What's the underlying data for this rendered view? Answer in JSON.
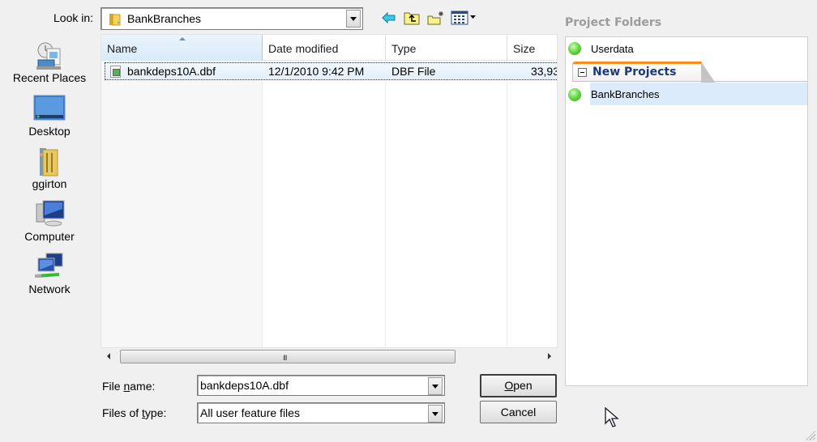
{
  "look_in": {
    "label": "Look in:",
    "label_access_key": "i",
    "value": "BankBranches"
  },
  "toolbar": {
    "icons": [
      "back-arrow-icon",
      "up-folder-icon",
      "new-folder-icon",
      "view-menu-icon"
    ]
  },
  "places": [
    {
      "label": "Recent Places",
      "icon": "recent-places-icon"
    },
    {
      "label": "Desktop",
      "icon": "desktop-icon"
    },
    {
      "label": "ggirton",
      "icon": "user-folder-icon"
    },
    {
      "label": "Computer",
      "icon": "computer-icon"
    },
    {
      "label": "Network",
      "icon": "network-icon"
    }
  ],
  "file_list": {
    "columns": [
      {
        "label": "Name",
        "sorted": "ascending"
      },
      {
        "label": "Date modified"
      },
      {
        "label": "Type"
      },
      {
        "label": "Size"
      }
    ],
    "rows": [
      {
        "name": "bankdeps10A.dbf",
        "date_modified": "12/1/2010 9:42 PM",
        "type": "DBF File",
        "size": "33,93",
        "selected": true
      }
    ]
  },
  "scrollbar": {
    "grip": "III"
  },
  "file_name": {
    "label_pre": "File ",
    "label_key": "n",
    "label_post": "ame:",
    "value": "bankdeps10A.dbf"
  },
  "file_type": {
    "label_pre": "Files of ",
    "label_key": "t",
    "label_post": "ype:",
    "value": "All user feature files"
  },
  "buttons": {
    "open_key": "O",
    "open_rest": "pen",
    "cancel": "Cancel"
  },
  "project_folders": {
    "title": "Project Folders",
    "items": [
      {
        "label": "Userdata",
        "status_color": "#5ccf3c"
      }
    ],
    "group": {
      "label": "New Projects",
      "accent_color": "#ff8a1e",
      "items": [
        {
          "label": "BankBranches",
          "status_color": "#5ccf3c",
          "selected": true
        }
      ]
    }
  }
}
